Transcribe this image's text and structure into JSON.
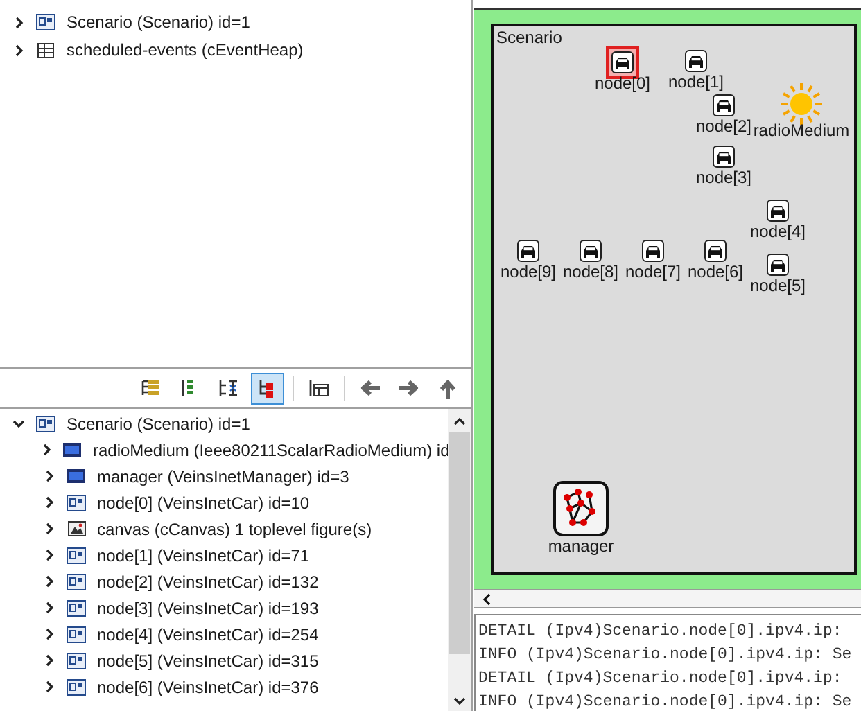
{
  "object_tree": {
    "items": [
      {
        "label": "Scenario (Scenario) id=1",
        "kind": "module",
        "expanded": false
      },
      {
        "label": "scheduled-events (cEventHeap)",
        "kind": "queue",
        "expanded": false
      }
    ]
  },
  "toolbar": {
    "buttons": [
      {
        "kind": "tree",
        "selected": false
      },
      {
        "kind": "flat",
        "selected": false
      },
      {
        "kind": "children",
        "selected": false
      },
      {
        "kind": "inheritance",
        "selected": true
      },
      {
        "kind": "details",
        "selected": false
      },
      {
        "kind": "back",
        "selected": false
      },
      {
        "kind": "forward",
        "selected": false
      },
      {
        "kind": "up",
        "selected": false
      }
    ]
  },
  "module_tree": {
    "items": [
      {
        "label": "Scenario (Scenario) id=1",
        "kind": "module",
        "expanded": true,
        "children": [
          {
            "label": "radioMedium (Ieee80211ScalarRadioMedium) id",
            "kind": "simple",
            "expanded": false
          },
          {
            "label": "manager (VeinsInetManager) id=3",
            "kind": "simple",
            "expanded": false
          },
          {
            "label": "node[0] (VeinsInetCar) id=10",
            "kind": "module",
            "expanded": false
          },
          {
            "label": "canvas (cCanvas) 1 toplevel figure(s)",
            "kind": "canvas",
            "expanded": false
          },
          {
            "label": "node[1] (VeinsInetCar) id=71",
            "kind": "module",
            "expanded": false
          },
          {
            "label": "node[2] (VeinsInetCar) id=132",
            "kind": "module",
            "expanded": false
          },
          {
            "label": "node[3] (VeinsInetCar) id=193",
            "kind": "module",
            "expanded": false
          },
          {
            "label": "node[4] (VeinsInetCar) id=254",
            "kind": "module",
            "expanded": false
          },
          {
            "label": "node[5] (VeinsInetCar) id=315",
            "kind": "module",
            "expanded": false
          },
          {
            "label": "node[6] (VeinsInetCar) id=376",
            "kind": "module",
            "expanded": false
          }
        ]
      }
    ]
  },
  "network_canvas": {
    "title": "Scenario",
    "submodules": [
      {
        "label": "node[0]",
        "kind": "car",
        "selected": true
      },
      {
        "label": "node[1]",
        "kind": "car",
        "selected": false
      },
      {
        "label": "node[2]",
        "kind": "car",
        "selected": false
      },
      {
        "label": "radioMedium",
        "kind": "sun",
        "selected": false
      },
      {
        "label": "node[3]",
        "kind": "car",
        "selected": false
      },
      {
        "label": "node[4]",
        "kind": "car",
        "selected": false
      },
      {
        "label": "node[5]",
        "kind": "car",
        "selected": false
      },
      {
        "label": "node[9]",
        "kind": "car",
        "selected": false
      },
      {
        "label": "node[8]",
        "kind": "car",
        "selected": false
      },
      {
        "label": "node[7]",
        "kind": "car",
        "selected": false
      },
      {
        "label": "node[6]",
        "kind": "car",
        "selected": false
      },
      {
        "label": "manager",
        "kind": "network",
        "selected": false
      }
    ]
  },
  "log": {
    "lines": [
      "DETAIL (Ipv4)Scenario.node[0].ipv4.ip:",
      "INFO (Ipv4)Scenario.node[0].ipv4.ip: Se",
      "DETAIL (Ipv4)Scenario.node[0].ipv4.ip:",
      "INFO (Ipv4)Scenario.node[0].ipv4.ip: Se"
    ]
  }
}
